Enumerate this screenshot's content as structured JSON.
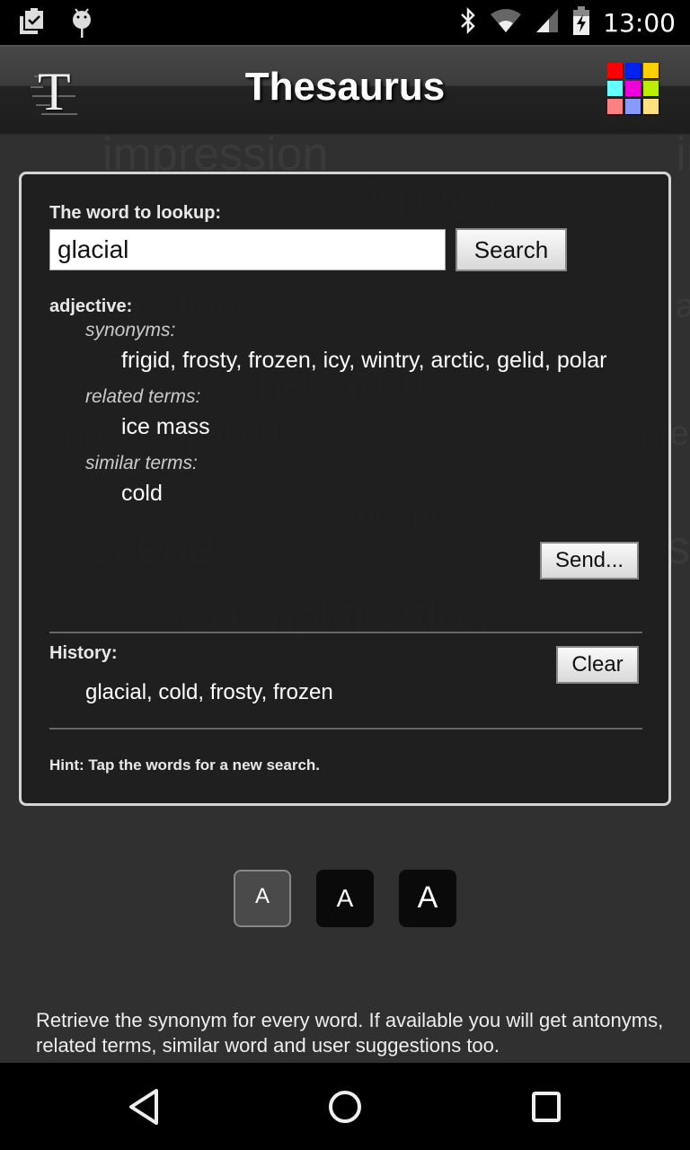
{
  "status_bar": {
    "time": "13:00",
    "left_icons": [
      "clipboard-check-icon",
      "android-debug-icon"
    ],
    "right_icons": [
      "bluetooth-icon",
      "wifi-icon",
      "cell-signal-icon",
      "battery-charging-icon"
    ]
  },
  "app_bar": {
    "title": "Thesaurus",
    "logo_letter": "T",
    "color_grid": [
      "#ff0000",
      "#0022ee",
      "#ffd000",
      "#66ffff",
      "#ee00dd",
      "#bbee00",
      "#ff8080",
      "#8899ff",
      "#ffe080"
    ]
  },
  "background_words": [
    "impression",
    "depiction",
    "abstraction",
    "thesaurus",
    "preoccupation",
    "concept",
    "scene",
    "exemplification"
  ],
  "lookup": {
    "label": "The word to lookup:",
    "value": "glacial",
    "search_label": "Search"
  },
  "results": {
    "part_of_speech": "adjective:",
    "groups": [
      {
        "label": "synonyms:",
        "words": "frigid, frosty, frozen, icy, wintry, arctic, gelid, polar"
      },
      {
        "label": "related terms:",
        "words": "ice mass"
      },
      {
        "label": "similar terms:",
        "words": "cold"
      }
    ],
    "send_label": "Send..."
  },
  "history": {
    "label": "History:",
    "clear_label": "Clear",
    "words": "glacial, cold, frosty, frozen"
  },
  "hint": "Hint: Tap the words for a new search.",
  "font_size_buttons": [
    {
      "label": "A",
      "size": "small",
      "selected": true
    },
    {
      "label": "A",
      "size": "medium",
      "selected": false
    },
    {
      "label": "A",
      "size": "large",
      "selected": false
    }
  ],
  "description": "Retrieve the synonym for every word. If available you will get antonyms, related terms, similar word and user suggestions too.",
  "nav_bar": {
    "buttons": [
      "back-icon",
      "home-icon",
      "recents-icon"
    ]
  }
}
